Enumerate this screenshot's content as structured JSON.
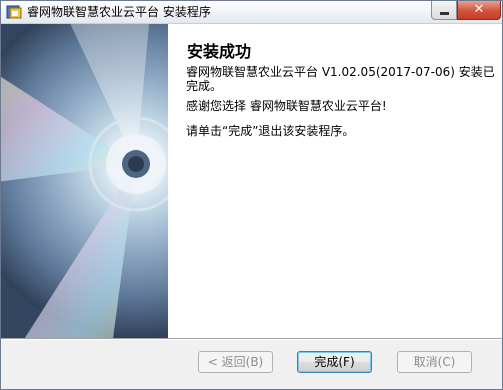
{
  "window": {
    "title": "睿网物联智慧农业云平台 安装程序",
    "close_label": "✕"
  },
  "content": {
    "heading": "安装成功",
    "message_complete": "睿网物联智慧农业云平台 V1.02.05(2017-07-06) 安装已完成。",
    "message_thanks": "感谢您选择 睿网物联智慧农业云平台!",
    "message_exit": "请单击“完成”退出该安装程序。"
  },
  "buttons": {
    "back": "< 返回(B)",
    "finish": "完成(F)",
    "cancel": "取消(C)"
  },
  "colors": {
    "close_button": "#c8442b",
    "content_background": "#ffffff",
    "dialog_background": "#f0f0f0"
  },
  "icons": {
    "app": "installer-app-icon",
    "minimize": "minimize-icon",
    "close": "close-icon",
    "banner": "cd-disc-graphic"
  }
}
